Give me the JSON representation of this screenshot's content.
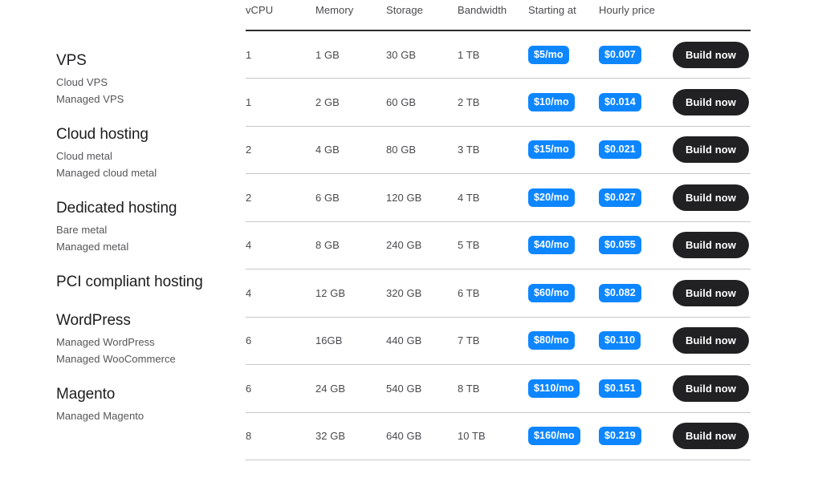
{
  "sidebar": {
    "groups": [
      {
        "heading": "VPS",
        "links": [
          "Cloud VPS",
          "Managed VPS"
        ]
      },
      {
        "heading": "Cloud hosting",
        "links": [
          "Cloud metal",
          "Managed cloud metal"
        ]
      },
      {
        "heading": "Dedicated hosting",
        "links": [
          "Bare metal",
          "Managed metal"
        ]
      },
      {
        "heading": "PCI compliant hosting",
        "links": []
      },
      {
        "heading": "WordPress",
        "links": [
          "Managed WordPress",
          "Managed WooCommerce"
        ]
      },
      {
        "heading": "Magento",
        "links": [
          "Managed Magento"
        ]
      }
    ]
  },
  "table": {
    "columns": [
      "vCPU",
      "Memory",
      "Storage",
      "Bandwidth",
      "Starting at",
      "Hourly price",
      ""
    ],
    "action_label": "Build now",
    "accent_color": "#0d86ff",
    "button_color": "#212124",
    "rows": [
      {
        "vcpu": "1",
        "memory": "1 GB",
        "storage": "30 GB",
        "bandwidth": "1 TB",
        "starting_at": "$5/mo",
        "hourly_price": "$0.007",
        "action": "Build now"
      },
      {
        "vcpu": "1",
        "memory": "2 GB",
        "storage": "60 GB",
        "bandwidth": "2 TB",
        "starting_at": "$10/mo",
        "hourly_price": "$0.014",
        "action": "Build now"
      },
      {
        "vcpu": "2",
        "memory": "4 GB",
        "storage": "80 GB",
        "bandwidth": "3 TB",
        "starting_at": "$15/mo",
        "hourly_price": "$0.021",
        "action": "Build now"
      },
      {
        "vcpu": "2",
        "memory": "6 GB",
        "storage": "120 GB",
        "bandwidth": "4 TB",
        "starting_at": "$20/mo",
        "hourly_price": "$0.027",
        "action": "Build now"
      },
      {
        "vcpu": "4",
        "memory": "8 GB",
        "storage": "240 GB",
        "bandwidth": "5 TB",
        "starting_at": "$40/mo",
        "hourly_price": "$0.055",
        "action": "Build now"
      },
      {
        "vcpu": "4",
        "memory": "12 GB",
        "storage": "320 GB",
        "bandwidth": "6 TB",
        "starting_at": "$60/mo",
        "hourly_price": "$0.082",
        "action": "Build now"
      },
      {
        "vcpu": "6",
        "memory": "16GB",
        "storage": "440 GB",
        "bandwidth": "7 TB",
        "starting_at": "$80/mo",
        "hourly_price": "$0.110",
        "action": "Build now"
      },
      {
        "vcpu": "6",
        "memory": "24 GB",
        "storage": "540 GB",
        "bandwidth": "8 TB",
        "starting_at": "$110/mo",
        "hourly_price": "$0.151",
        "action": "Build now"
      },
      {
        "vcpu": "8",
        "memory": "32 GB",
        "storage": "640 GB",
        "bandwidth": "10 TB",
        "starting_at": "$160/mo",
        "hourly_price": "$0.219",
        "action": "Build now"
      }
    ]
  }
}
